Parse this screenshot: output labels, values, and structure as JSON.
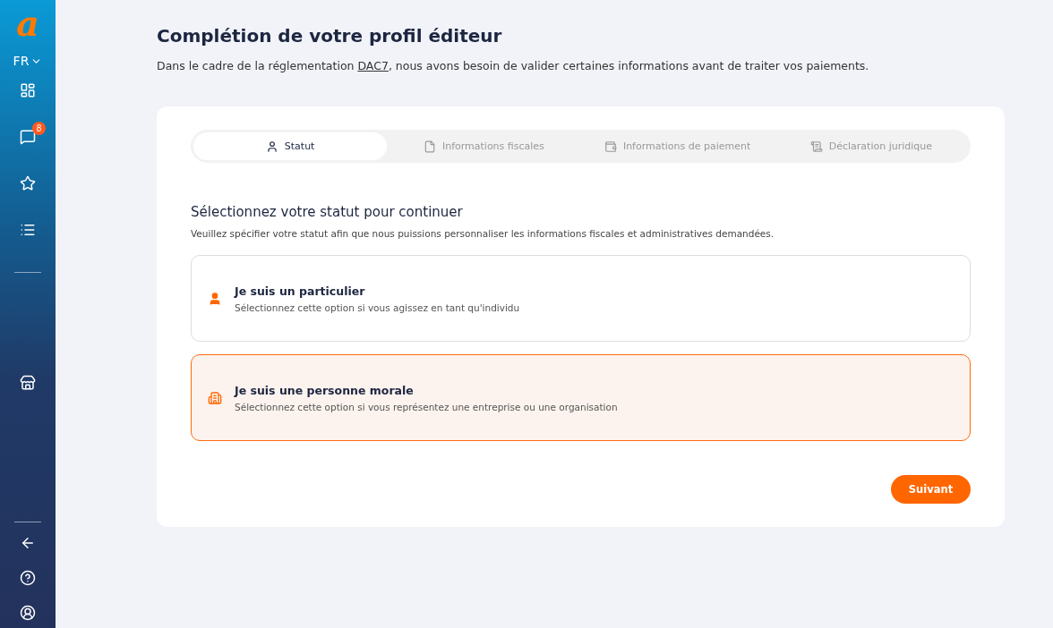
{
  "sidebar": {
    "logo": "a",
    "language": "FR",
    "nav_top": [
      {
        "kind": "dashboard"
      },
      {
        "kind": "messages",
        "badge": "8"
      },
      {
        "kind": "star"
      },
      {
        "kind": "list"
      }
    ],
    "nav_middle": [
      {
        "kind": "store"
      }
    ],
    "nav_bottom": [
      {
        "kind": "back"
      },
      {
        "kind": "help"
      },
      {
        "kind": "account"
      }
    ]
  },
  "page": {
    "title": "Complétion de votre profil éditeur",
    "intro": {
      "before": "Dans le cadre de la réglementation ",
      "link": "DAC7",
      "after": ", nous avons besoin de valider certaines informations avant de traiter vos paiements."
    }
  },
  "steps": [
    {
      "kind": "person",
      "label": "Statut",
      "selected": true
    },
    {
      "kind": "file",
      "label": "Informations fiscales",
      "selected": false
    },
    {
      "kind": "wallet",
      "label": "Informations de paiement",
      "selected": false
    },
    {
      "kind": "scroll",
      "label": "Déclaration juridique",
      "selected": false
    }
  ],
  "section": {
    "title": "Sélectionnez votre statut pour continuer",
    "description": "Veuillez spécifier votre statut afin que nous puissions personnaliser les informations fiscales et administratives demandées."
  },
  "options": [
    {
      "kind": "person",
      "title": "Je suis un particulier",
      "description": "Sélectionnez cette option si vous agissez en tant qu'individu",
      "selected": false
    },
    {
      "kind": "company",
      "title": "Je suis une personne morale",
      "description": "Sélectionnez cette option si vous représentez une entreprise ou une organisation",
      "selected": true
    }
  ],
  "next_button": "Suivant"
}
